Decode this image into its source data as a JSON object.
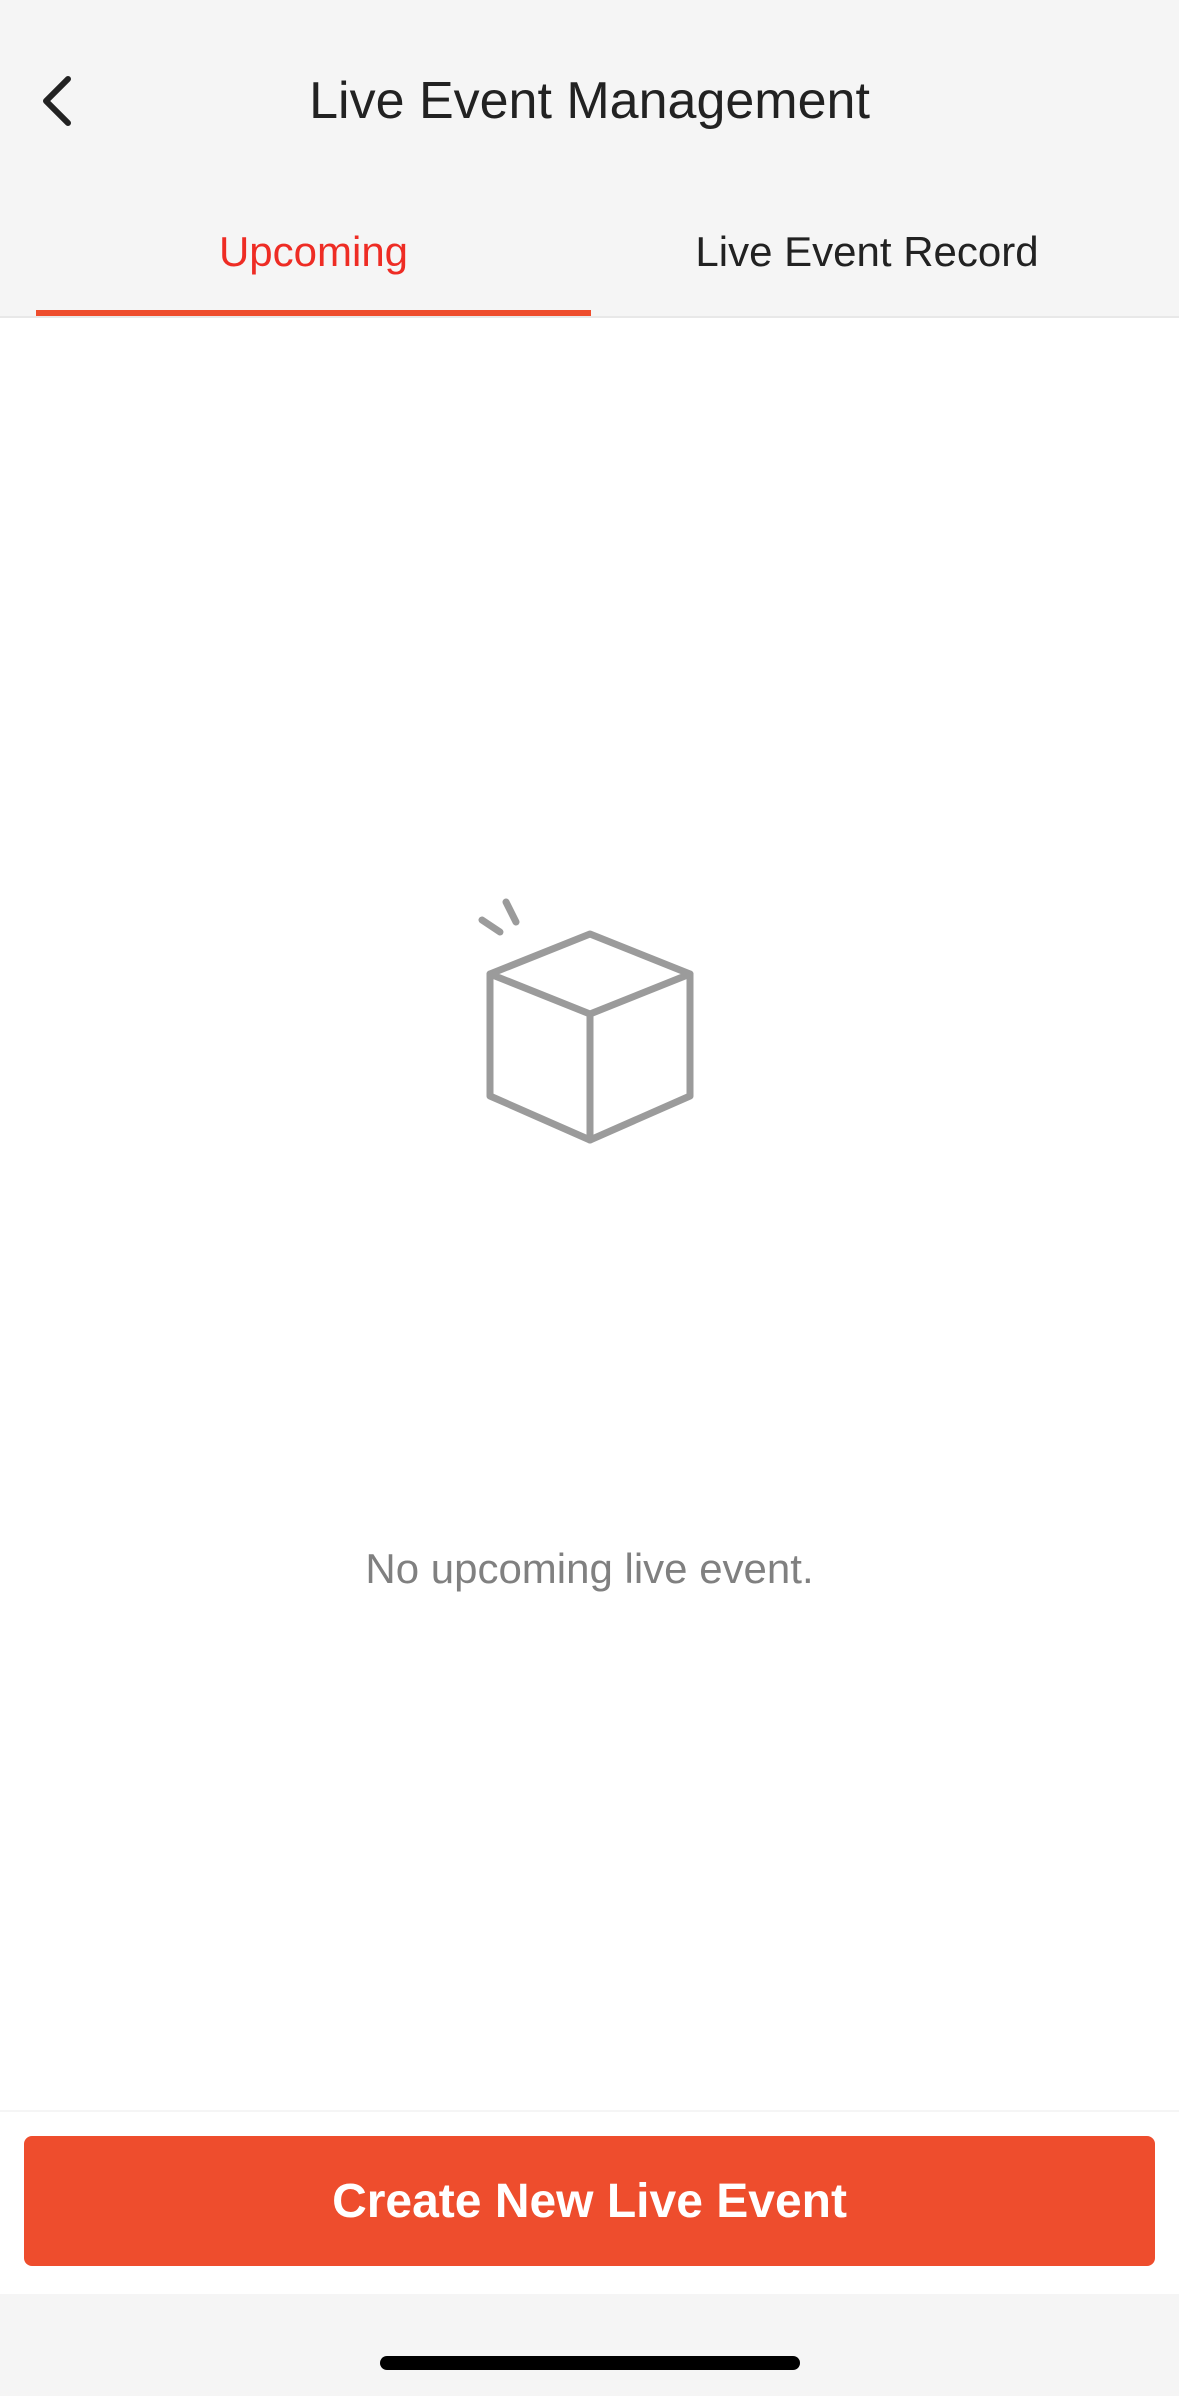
{
  "header": {
    "title": "Live Event Management",
    "back_icon": "chevron-left-icon"
  },
  "tabs": [
    {
      "label": "Upcoming",
      "active": true
    },
    {
      "label": "Live Event Record",
      "active": false
    }
  ],
  "empty_state": {
    "icon": "empty-box-icon",
    "message": "No upcoming live event."
  },
  "footer": {
    "create_button_label": "Create New Live Event"
  },
  "colors": {
    "accent": "#ee4d2d",
    "active_tab_text": "#ee2c24",
    "muted_text": "#808080",
    "icon_stroke": "#9b9b9b"
  }
}
